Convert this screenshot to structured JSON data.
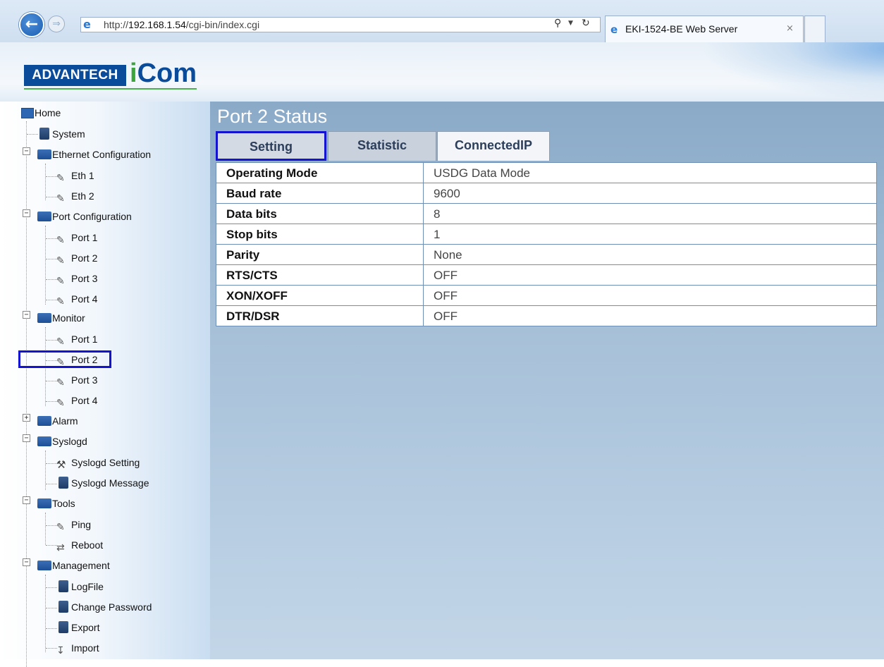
{
  "browser": {
    "url_prefix": "http://",
    "url_host": "192.168.1.54",
    "url_path": "/cgi-bin/index.cgi",
    "search_icon": "search-icon",
    "tab_title": "EKI-1524-BE Web Server",
    "tab_close": "×"
  },
  "header": {
    "logo_brand": "ADVANTECH",
    "logo_product_i": "i",
    "logo_product_rest": "Com"
  },
  "sidebar": {
    "home": "Home",
    "system": "System",
    "ethernet_configuration": "Ethernet Configuration",
    "eth1": "Eth 1",
    "eth2": "Eth 2",
    "port_configuration": "Port Configuration",
    "pc_port1": "Port 1",
    "pc_port2": "Port 2",
    "pc_port3": "Port 3",
    "pc_port4": "Port 4",
    "monitor": "Monitor",
    "mon_port1": "Port 1",
    "mon_port2": "Port 2",
    "mon_port3": "Port 3",
    "mon_port4": "Port 4",
    "alarm": "Alarm",
    "syslogd": "Syslogd",
    "syslogd_setting": "Syslogd Setting",
    "syslogd_message": "Syslogd Message",
    "tools": "Tools",
    "ping": "Ping",
    "reboot": "Reboot",
    "management": "Management",
    "logfile": "LogFile",
    "change_password": "Change Password",
    "export": "Export",
    "import": "Import"
  },
  "main": {
    "title": "Port 2 Status",
    "tabs": {
      "setting": "Setting",
      "statistic": "Statistic",
      "connectedip": "ConnectedIP"
    },
    "rows": [
      {
        "label": "Operating Mode",
        "value": "USDG Data Mode"
      },
      {
        "label": "Baud rate",
        "value": "9600"
      },
      {
        "label": "Data bits",
        "value": "8"
      },
      {
        "label": "Stop bits",
        "value": "1"
      },
      {
        "label": "Parity",
        "value": "None"
      },
      {
        "label": "RTS/CTS",
        "value": "OFF"
      },
      {
        "label": "XON/XOFF",
        "value": "OFF"
      },
      {
        "label": "DTR/DSR",
        "value": "OFF"
      }
    ]
  },
  "colors": {
    "highlight": "#1414d0",
    "brand_blue": "#0a4c9a",
    "brand_green": "#3aa63a"
  }
}
